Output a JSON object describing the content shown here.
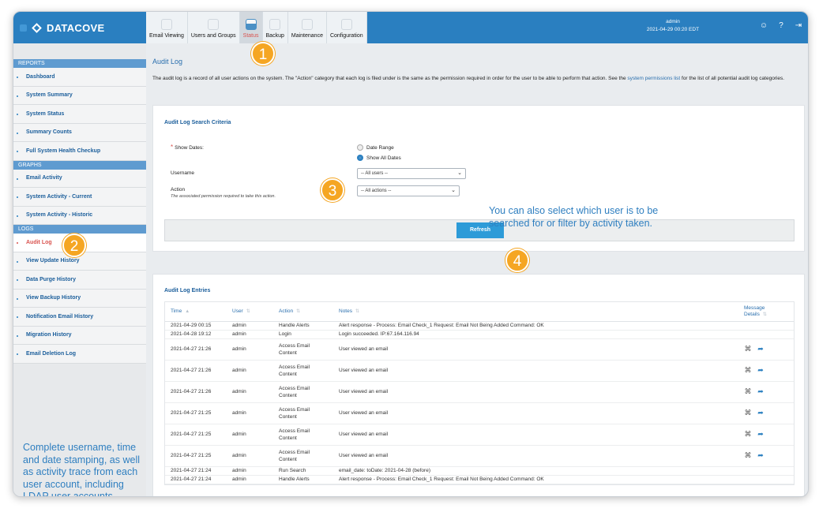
{
  "header": {
    "brand": "DATACOVE",
    "tabs": [
      {
        "label": "Email Viewing",
        "icon": "envelope-icon"
      },
      {
        "label": "Users and Groups",
        "icon": "users-icon"
      },
      {
        "label": "Status",
        "icon": "bar-chart-icon",
        "active": true
      },
      {
        "label": "Backup",
        "icon": "backup-icon"
      },
      {
        "label": "Maintenance",
        "icon": "gear-icon"
      },
      {
        "label": "Configuration",
        "icon": "config-icon"
      }
    ],
    "user": "admin",
    "datetime": "2021-04-29 00:20 EDT"
  },
  "sidebar": {
    "reports_title": "REPORTS",
    "reports": [
      "Dashboard",
      "System Summary",
      "System Status",
      "Summary Counts",
      "Full System Health Checkup"
    ],
    "graphs_title": "GRAPHS",
    "graphs": [
      "Email Activity",
      "System Activity - Current",
      "System Activity - Historic"
    ],
    "logs_title": "LOGS",
    "logs": [
      "Audit Log",
      "View Update History",
      "Data Purge History",
      "View Backup History",
      "Notification Email History",
      "Migration History",
      "Email Deletion Log"
    ],
    "blurb": "Complete username, time and date stamping, as well as activity trace from each user account, including LDAP user accounts."
  },
  "main": {
    "title": "Audit Log",
    "desc_part1": "The audit log is a record of all user actions on the system. The \"Action\" category that each log is filed under is the same as the permission required in order for the user to be able to perform that action. See the ",
    "desc_link": "system permissions list",
    "desc_part2": " for the list of all potential audit log categories.",
    "criteria": {
      "title": "Audit Log Search Criteria",
      "show_dates_label": "Show Dates:",
      "radio_range": "Date Range",
      "radio_all": "Show All Dates",
      "username_label": "Username",
      "username_value": "-- All users --",
      "action_label": "Action",
      "action_sub": "The associated permission required to take this action.",
      "action_value": "-- All actions --",
      "refresh": "Refresh"
    },
    "note": "You can also select which user is to be searched for or filter by activity taken.",
    "entries": {
      "title": "Audit Log Entries",
      "columns": [
        "Time",
        "User",
        "Action",
        "Notes",
        "Message Details"
      ],
      "rows": [
        {
          "time": "2021-04-29 00:15",
          "user": "admin",
          "action": "Handle Alerts",
          "notes": "Alert response - Process: Email Check_1 Request: Email Not Being Added Command: OK",
          "icons": false
        },
        {
          "time": "2021-04-28 19:12",
          "user": "admin",
          "action": "Login",
          "notes": "Login succeeded. IP:67.164.116.94",
          "icons": false
        },
        {
          "time": "2021-04-27 21:26",
          "user": "admin",
          "action": "Access Email Content",
          "notes": "User viewed an email",
          "icons": true
        },
        {
          "time": "2021-04-27 21:26",
          "user": "admin",
          "action": "Access Email Content",
          "notes": "User viewed an email",
          "icons": true
        },
        {
          "time": "2021-04-27 21:26",
          "user": "admin",
          "action": "Access Email Content",
          "notes": "User viewed an email",
          "icons": true
        },
        {
          "time": "2021-04-27 21:25",
          "user": "admin",
          "action": "Access Email Content",
          "notes": "User viewed an email",
          "icons": true
        },
        {
          "time": "2021-04-27 21:25",
          "user": "admin",
          "action": "Access Email Content",
          "notes": "User viewed an email",
          "icons": true
        },
        {
          "time": "2021-04-27 21:25",
          "user": "admin",
          "action": "Access Email Content",
          "notes": "User viewed an email",
          "icons": true
        },
        {
          "time": "2021-04-27 21:24",
          "user": "admin",
          "action": "Run Search",
          "notes": "email_date: toDate: 2021-04-28 (before)",
          "icons": false
        },
        {
          "time": "2021-04-27 21:24",
          "user": "admin",
          "action": "Handle Alerts",
          "notes": "Alert response - Process: Email Check_1 Request: Email Not Being Added Command: OK",
          "icons": false
        }
      ]
    }
  },
  "badges": [
    "1",
    "2",
    "3",
    "4"
  ],
  "colors": {
    "accent": "#2a7fc0",
    "badge": "#f5a623",
    "active_red": "#d9534f"
  }
}
